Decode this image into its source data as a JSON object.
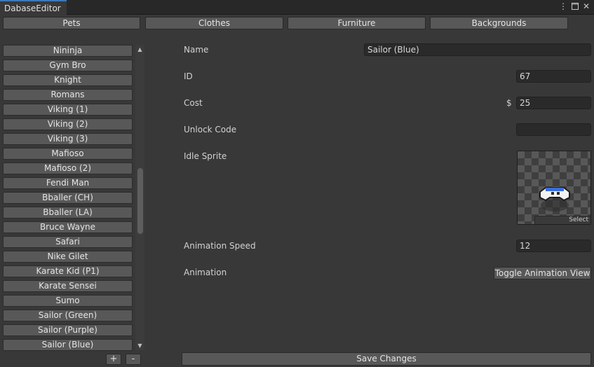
{
  "window": {
    "tab_title": "DabaseEditor",
    "menu_icon": "kebab-menu-icon",
    "maximize_icon": "maximize-icon",
    "close_icon": "close-icon"
  },
  "categories": [
    "Pets",
    "Clothes",
    "Furniture",
    "Backgrounds"
  ],
  "list": {
    "items": [
      "Nininja",
      "Gym Bro",
      "Knight",
      "Romans",
      "Viking (1)",
      "Viking (2)",
      "Viking (3)",
      "Mafioso",
      "Mafioso (2)",
      "Fendi Man",
      "Bballer (CH)",
      "Bballer (LA)",
      "Bruce Wayne",
      "Safari",
      "Nike Gilet",
      "Karate Kid (P1)",
      "Karate Sensei",
      "Sumo",
      "Sailor (Green)",
      "Sailor (Purple)",
      "Sailor (Blue)"
    ],
    "add_label": "+",
    "remove_label": "-"
  },
  "details": {
    "name_label": "Name",
    "name_value": "Sailor (Blue)",
    "id_label": "ID",
    "id_value": "67",
    "cost_label": "Cost",
    "currency_symbol": "$",
    "cost_value": "25",
    "unlock_label": "Unlock Code",
    "unlock_value": "",
    "sprite_label": "Idle Sprite",
    "sprite_select_label": "Select",
    "anim_speed_label": "Animation Speed",
    "anim_speed_value": "12",
    "animation_label": "Animation",
    "toggle_anim_label": "Toggle Animation View"
  },
  "save_label": "Save Changes"
}
